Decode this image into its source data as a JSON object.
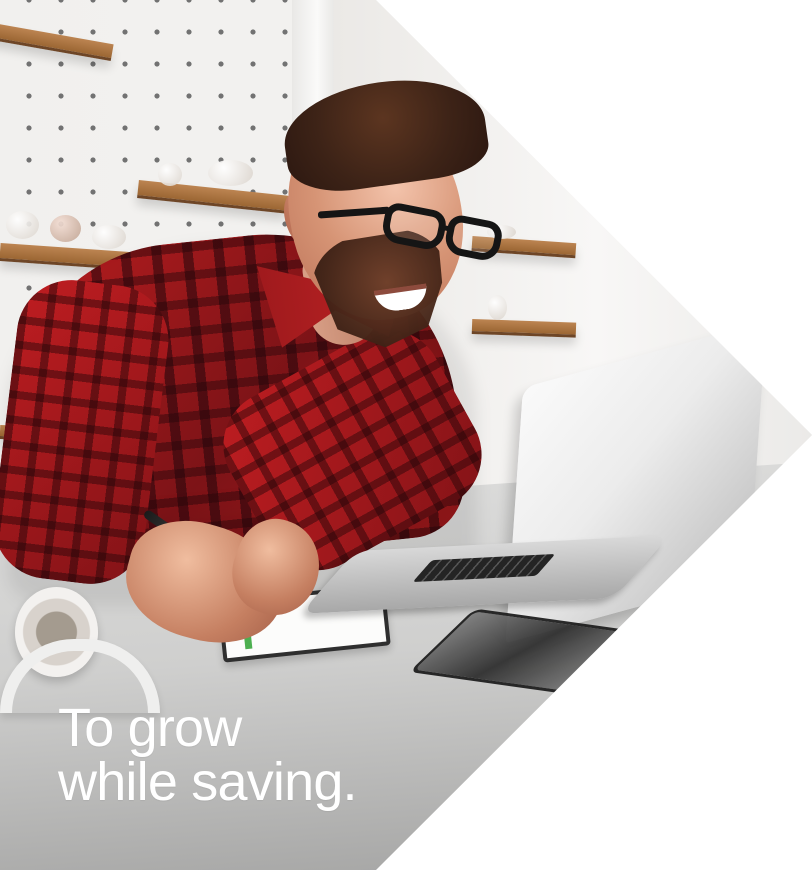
{
  "hero": {
    "tagline_lines": [
      "To grow",
      "while saving."
    ],
    "text_color": "#ffffff",
    "background_color": "#ffffff"
  },
  "photo": {
    "subject": "man-working-at-laptop",
    "objects": [
      "plaid-shirt",
      "eyeglasses",
      "laptop",
      "notebook",
      "pen",
      "headphones",
      "tablet",
      "kitchen-shelves"
    ],
    "colors": {
      "shirt_red": "#b91d1f",
      "shelf_wood": "#a86d39",
      "laptop_silver": "#d8d8d8"
    }
  }
}
